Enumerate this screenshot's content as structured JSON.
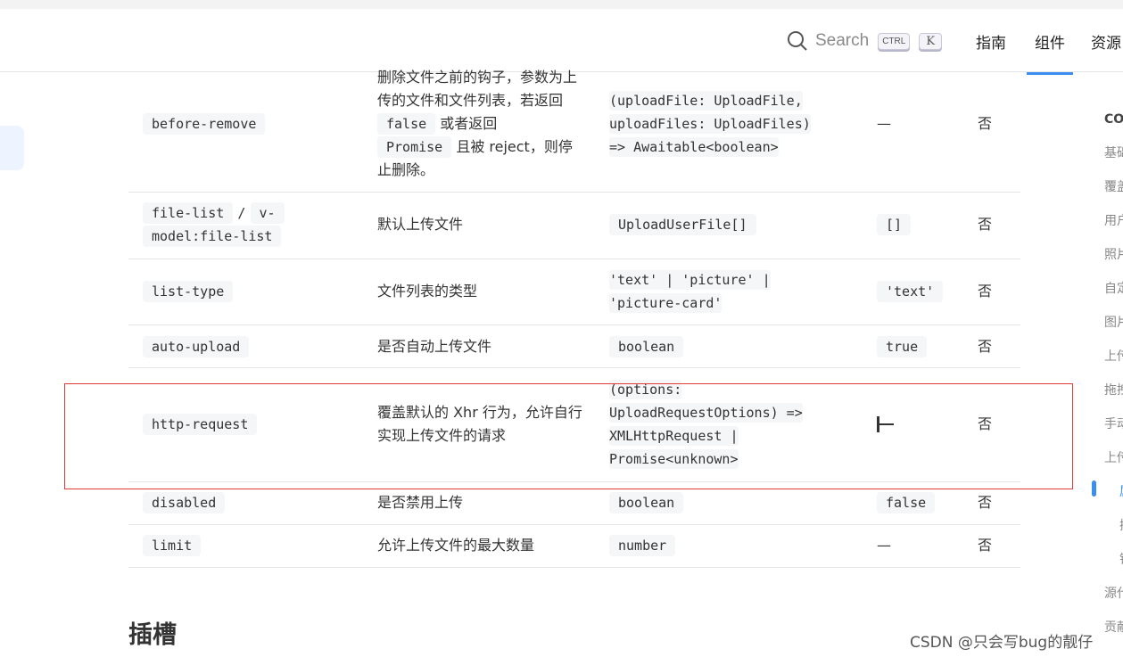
{
  "header": {
    "search_label": "Search",
    "kbd_ctrl": "CTRL",
    "kbd_k": "K",
    "nav": [
      {
        "label": "指南"
      },
      {
        "label": "组件",
        "active": true
      },
      {
        "label": "资源"
      }
    ]
  },
  "rows": [
    {
      "name": "before-remove",
      "desc_parts": [
        "删除文件之前的钩子，参数为上传的文件和文件列表，若返回",
        "false",
        "或者返回",
        "Promise",
        "且被 reject，则停止删除。"
      ],
      "type": [
        "(uploadFile: UploadFile,",
        "uploadFiles: UploadFiles)",
        "=> Awaitable<boolean>"
      ],
      "default": "—",
      "required": "否"
    },
    {
      "name_parts": [
        "file-list",
        "/",
        "v-",
        "model:file-list"
      ],
      "desc": "默认上传文件",
      "type": [
        "UploadUserFile[]"
      ],
      "default": "[]",
      "required": "否"
    },
    {
      "name": "list-type",
      "desc": "文件列表的类型",
      "type": [
        "'text' | 'picture' |",
        "'picture-card'"
      ],
      "default": "'text'",
      "required": "否"
    },
    {
      "name": "auto-upload",
      "desc": "是否自动上传文件",
      "type": [
        "boolean"
      ],
      "default": "true",
      "required": "否"
    },
    {
      "name": "http-request",
      "desc": "覆盖默认的 Xhr 行为，允许自行实现上传文件的请求",
      "type": [
        "(options:",
        "UploadRequestOptions) =>",
        "XMLHttpRequest |",
        "Promise<unknown>"
      ],
      "default": "—",
      "required": "否"
    },
    {
      "name": "disabled",
      "desc": "是否禁用上传",
      "type": [
        "boolean"
      ],
      "default": "false",
      "required": "否"
    },
    {
      "name": "limit",
      "desc": "允许上传文件的最大数量",
      "type": [
        "number"
      ],
      "default": "—",
      "required": "否"
    }
  ],
  "toc": [
    "CO",
    "基础",
    "覆盖",
    "用户",
    "照片",
    "自定",
    "图片",
    "上传",
    "拖拽",
    "手动",
    "上传",
    "属性",
    "插",
    "钩",
    "源代",
    "贡献"
  ],
  "section_heading": "插槽",
  "watermark": "CSDN @只会写bug的靓仔",
  "colors": {
    "accent": "#3b8ef0",
    "highlight_box": "#e53935",
    "code_bg": "#f5f6f8"
  }
}
